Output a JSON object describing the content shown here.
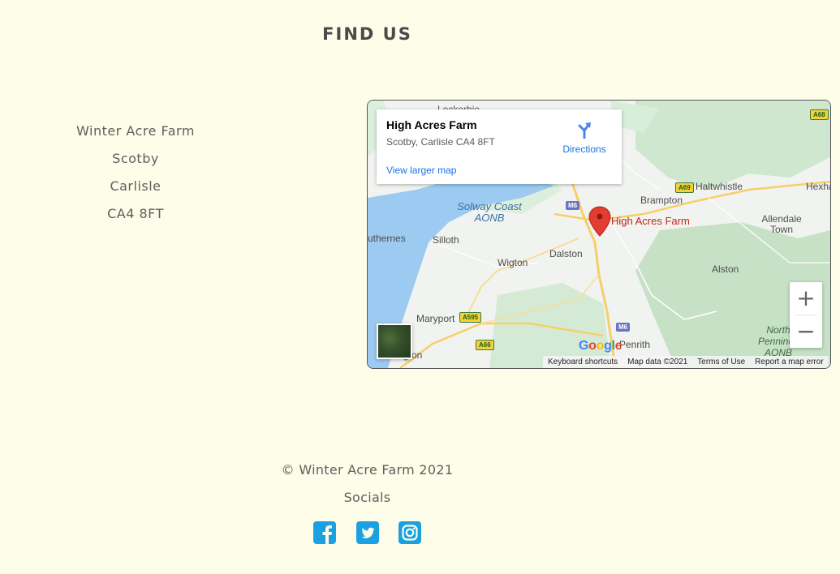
{
  "page": {
    "heading": "FIND US",
    "address_lines": [
      "Winter Acre Farm",
      "Scotby",
      "Carlisle",
      "CA4 8FT"
    ],
    "copyright": "© Winter Acre Farm 2021",
    "socials_label": "Socials"
  },
  "colors": {
    "background": "#fdfde9",
    "social_icons": "#1ba1e2",
    "map_marker": "#e33d32",
    "map_link": "#1a73e8"
  },
  "socials": [
    {
      "icon": "facebook-icon"
    },
    {
      "icon": "twitter-icon"
    },
    {
      "icon": "instagram-icon"
    }
  ],
  "map": {
    "place_title": "High Acres Farm",
    "place_address": "Scotby, Carlisle CA4 8FT",
    "directions_label": "Directions",
    "view_larger_label": "View larger map",
    "marker_label": "High Acres Farm",
    "google_logo": "Google",
    "footer": {
      "shortcuts": "Keyboard shortcuts",
      "map_data": "Map data ©2021",
      "terms": "Terms of Use",
      "report": "Report a map error"
    },
    "zoom_in": "+",
    "zoom_out": "−",
    "places": [
      "Lockerbie",
      "Brampton",
      "Haltwhistle",
      "Hexha",
      "Allendale Town",
      "Solway Coast AONB",
      "uthernes",
      "Silloth",
      "Wigton",
      "Dalston",
      "Alston",
      "Maryport",
      "North Pennines AONB",
      "Penrith",
      "gton"
    ],
    "roads": [
      "A68",
      "A69",
      "M6",
      "A595",
      "A66",
      "M6"
    ]
  }
}
